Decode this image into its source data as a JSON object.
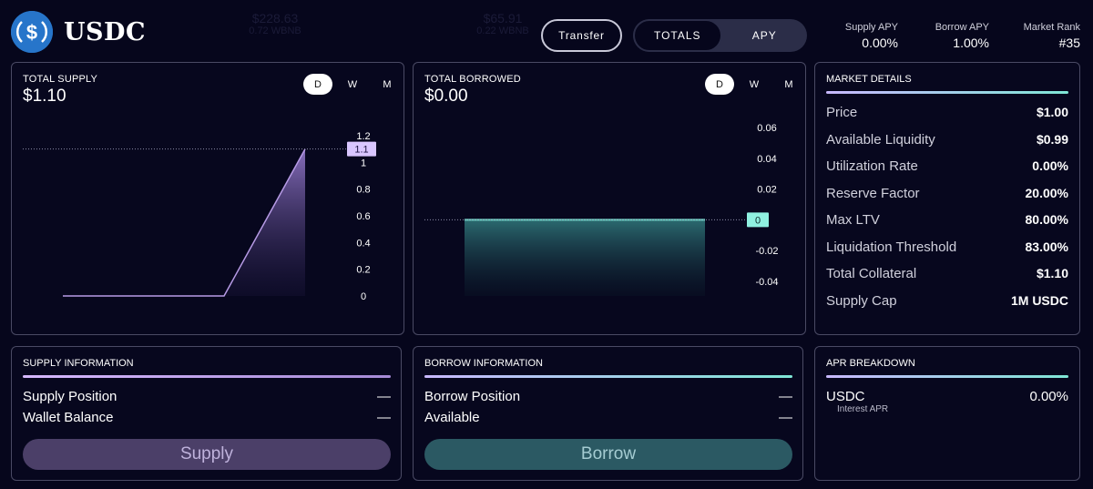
{
  "header": {
    "token": "USDC",
    "transfer_label": "Transfer",
    "toggle": [
      {
        "label": "TOTALS",
        "active": true
      },
      {
        "label": "APY",
        "active": false
      }
    ],
    "stats": [
      {
        "label": "Supply APY",
        "value": "0.00%"
      },
      {
        "label": "Borrow APY",
        "value": "1.00%"
      },
      {
        "label": "Market Rank",
        "value": "#35"
      }
    ],
    "ghost": [
      {
        "value": "$228.63",
        "sub": "0.72 WBNB"
      },
      {
        "value": "$65.91",
        "sub": "0.22 WBNB"
      }
    ]
  },
  "supply_chart": {
    "title": "TOTAL SUPPLY",
    "value": "$1.10",
    "periods": [
      "D",
      "W",
      "M"
    ],
    "active_period": "D",
    "current_label": "1.1"
  },
  "borrow_chart": {
    "title": "TOTAL BORROWED",
    "value": "$0.00",
    "periods": [
      "D",
      "W",
      "M"
    ],
    "active_period": "D",
    "current_label": "0"
  },
  "chart_data": [
    {
      "type": "area",
      "title": "TOTAL SUPPLY",
      "x": [
        0,
        1,
        2
      ],
      "values": [
        0,
        0,
        1.1
      ],
      "yticks": [
        "1.2",
        "1",
        "0.8",
        "0.6",
        "0.4",
        "0.2",
        "0"
      ],
      "ylim": [
        0,
        1.2
      ],
      "color": "#b79be6"
    },
    {
      "type": "area",
      "title": "TOTAL BORROWED",
      "x": [
        0,
        1
      ],
      "values": [
        0,
        0
      ],
      "yticks": [
        "0.06",
        "0.04",
        "0.02",
        "-0.02",
        "-0.04"
      ],
      "ylim": [
        -0.05,
        0.07
      ],
      "color": "#6fd6c8"
    }
  ],
  "market": {
    "title": "MARKET DETAILS",
    "rows": [
      {
        "label": "Price",
        "value": "$1.00"
      },
      {
        "label": "Available Liquidity",
        "value": "$0.99"
      },
      {
        "label": "Utilization Rate",
        "value": "0.00%"
      },
      {
        "label": "Reserve Factor",
        "value": "20.00%"
      },
      {
        "label": "Max LTV",
        "value": "80.00%"
      },
      {
        "label": "Liquidation Threshold",
        "value": "83.00%"
      },
      {
        "label": "Total Collateral",
        "value": "$1.10"
      },
      {
        "label": "Supply Cap",
        "value": "1M USDC"
      }
    ]
  },
  "supply_info": {
    "title": "SUPPLY INFORMATION",
    "rows": [
      {
        "label": "Supply Position",
        "value": "—"
      },
      {
        "label": "Wallet Balance",
        "value": "—"
      }
    ],
    "button": "Supply"
  },
  "borrow_info": {
    "title": "BORROW INFORMATION",
    "rows": [
      {
        "label": "Borrow Position",
        "value": "—"
      },
      {
        "label": "Available",
        "value": "—"
      }
    ],
    "button": "Borrow"
  },
  "apr": {
    "title": "APR BREAKDOWN",
    "asset": "USDC",
    "sub": "Interest APR",
    "value": "0.00%"
  }
}
